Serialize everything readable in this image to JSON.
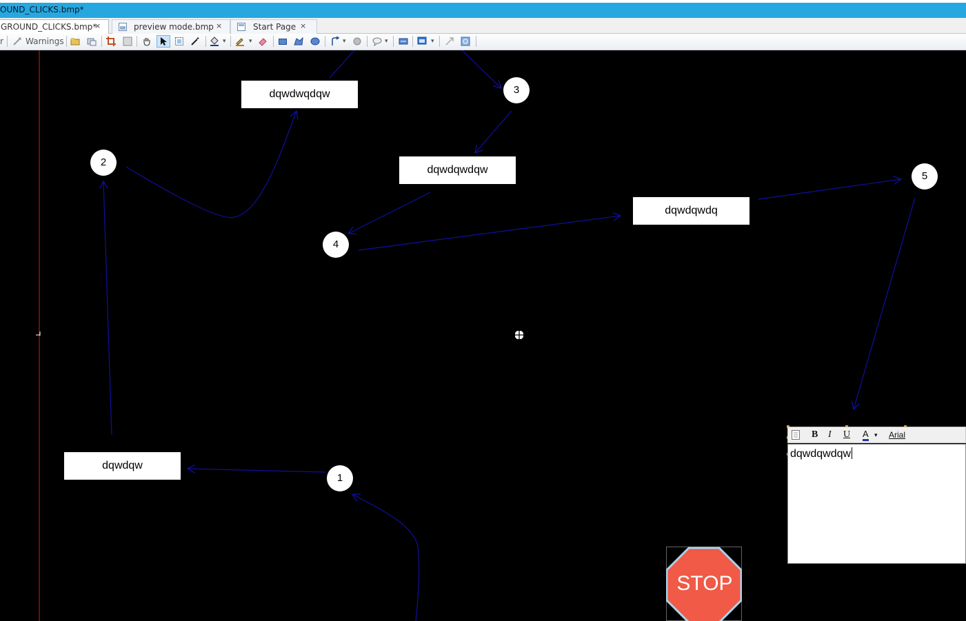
{
  "window": {
    "title": "OUND_CLICKS.bmp*"
  },
  "tabs": [
    {
      "label": "GROUND_CLICKS.bmp*",
      "close": "×",
      "active": true
    },
    {
      "label": "preview mode.bmp",
      "close": "×",
      "active": false
    },
    {
      "label": "Start Page",
      "close": "×",
      "active": false
    }
  ],
  "toolbar": {
    "left_fragment": "r",
    "warnings_label": "Warnings"
  },
  "diagram": {
    "nodes": [
      {
        "id": "1",
        "label": "1"
      },
      {
        "id": "2",
        "label": "2"
      },
      {
        "id": "3",
        "label": "3"
      },
      {
        "id": "4",
        "label": "4"
      },
      {
        "id": "5",
        "label": "5"
      }
    ],
    "boxes": [
      {
        "id": "a",
        "label": "dqwdwqdqw"
      },
      {
        "id": "b",
        "label": "dqwdqwdqw"
      },
      {
        "id": "c",
        "label": "dqwdqwdq"
      },
      {
        "id": "d",
        "label": "dqwdqw"
      }
    ],
    "arrow_color": "#1010a0",
    "stop_sign": {
      "label": "STOP",
      "color": "#f05a46"
    }
  },
  "text_editor": {
    "bold": "B",
    "italic": "I",
    "underline": "U",
    "font_color": "A",
    "font_name": "Arial",
    "content": "dqwdqwdqw"
  },
  "guide_line_color": "#d02020"
}
